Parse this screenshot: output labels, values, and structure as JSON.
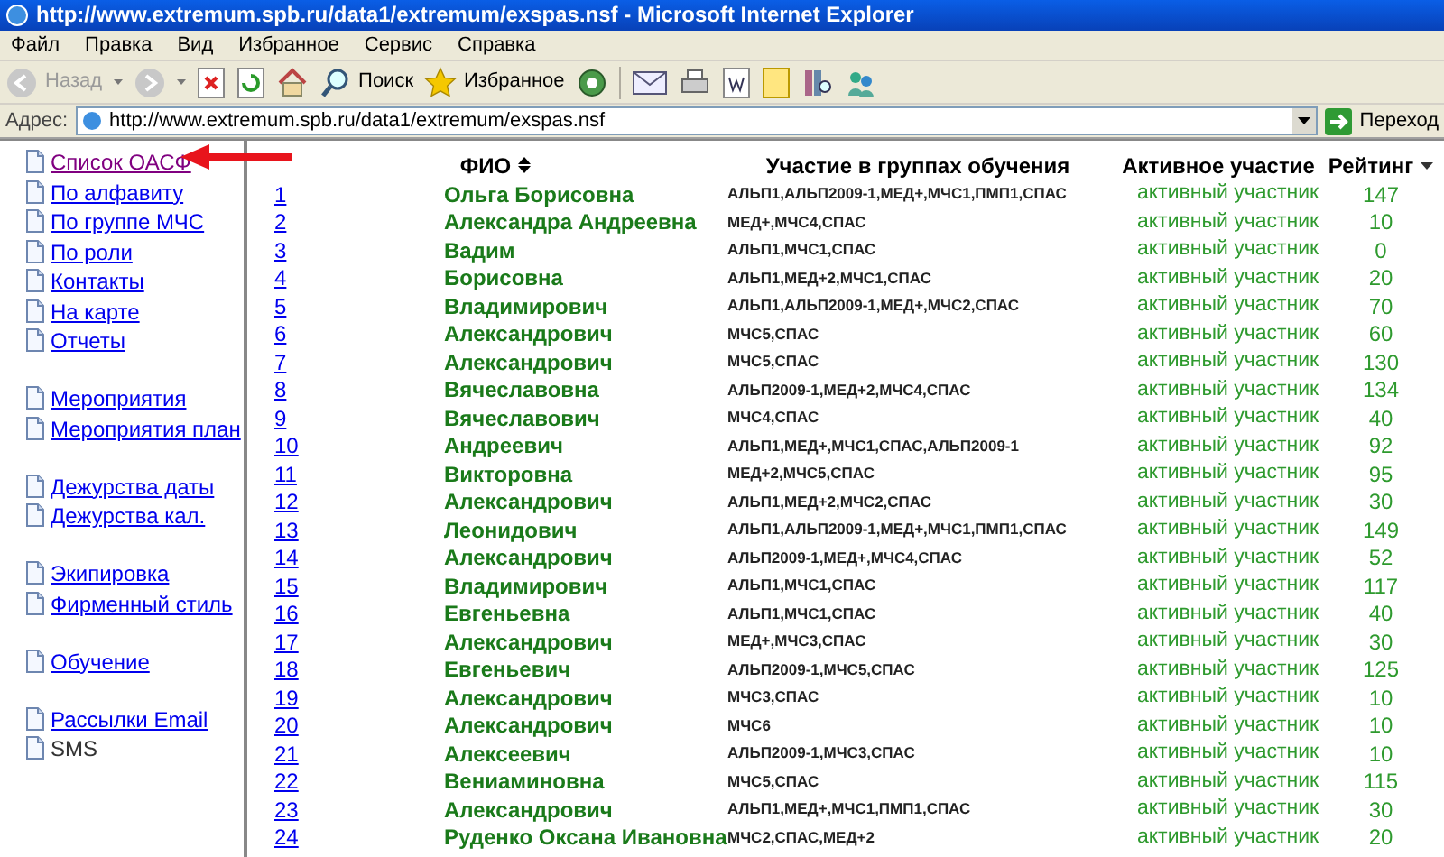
{
  "window": {
    "title": "http://www.extremum.spb.ru/data1/extremum/exspas.nsf - Microsoft Internet Explorer"
  },
  "menu": [
    "Файл",
    "Правка",
    "Вид",
    "Избранное",
    "Сервис",
    "Справка"
  ],
  "toolbar": {
    "back": {
      "label": "Назад",
      "disabled": true
    },
    "search": "Поиск",
    "favorites": "Избранное"
  },
  "address": {
    "label": "Адрес:",
    "value": "http://www.extremum.spb.ru/data1/extremum/exspas.nsf",
    "go": "Переход"
  },
  "sidebar": {
    "groups": [
      [
        {
          "label": "Список ОАСФ",
          "kind": "link",
          "visited": true
        },
        {
          "label": "По алфавиту",
          "kind": "link",
          "visited": false
        },
        {
          "label": "По группе МЧС",
          "kind": "link",
          "visited": false
        },
        {
          "label": "По роли",
          "kind": "link",
          "visited": false
        },
        {
          "label": "Контакты",
          "kind": "link",
          "visited": false
        },
        {
          "label": "На карте",
          "kind": "link",
          "visited": false
        },
        {
          "label": "Отчеты",
          "kind": "link",
          "visited": false
        }
      ],
      [
        {
          "label": "Мероприятия",
          "kind": "link",
          "visited": false
        },
        {
          "label": "Мероприятия план",
          "kind": "link",
          "visited": false
        }
      ],
      [
        {
          "label": "Дежурства даты",
          "kind": "link",
          "visited": false
        },
        {
          "label": "Дежурства кал.",
          "kind": "link",
          "visited": false
        }
      ],
      [
        {
          "label": "Экипировка",
          "kind": "link",
          "visited": false
        },
        {
          "label": "Фирменный стиль",
          "kind": "link",
          "visited": false
        }
      ],
      [
        {
          "label": "Обучение",
          "kind": "link",
          "visited": false
        }
      ],
      [
        {
          "label": "Рассылки Email",
          "kind": "link",
          "visited": false
        },
        {
          "label": "SMS",
          "kind": "text"
        }
      ]
    ]
  },
  "table": {
    "columns": [
      {
        "label": "ФИО",
        "kind": "sortable"
      },
      {
        "label": "Участие в группах обучения",
        "kind": "plain"
      },
      {
        "label": "Активное участие",
        "kind": "plain"
      },
      {
        "label": "Рейтинг",
        "kind": "sorted"
      }
    ],
    "rows": [
      {
        "n": "1",
        "name": "Ольга Борисовна",
        "groups": "АЛЬП1,АЛЬП2009-1,МЕД+,МЧС1,ПМП1,СПАС",
        "status": "активный участник",
        "rating": "147"
      },
      {
        "n": "2",
        "name": "Александра Андреевна",
        "groups": "МЕД+,МЧС4,СПАС",
        "status": "активный участник",
        "rating": "10"
      },
      {
        "n": "3",
        "name": "Вадим",
        "groups": "АЛЬП1,МЧС1,СПАС",
        "status": "активный участник",
        "rating": "0"
      },
      {
        "n": "4",
        "name": "Борисовна",
        "groups": "АЛЬП1,МЕД+2,МЧС1,СПАС",
        "status": "активный участник",
        "rating": "20"
      },
      {
        "n": "5",
        "name": "Владимирович",
        "groups": "АЛЬП1,АЛЬП2009-1,МЕД+,МЧС2,СПАС",
        "status": "активный участник",
        "rating": "70"
      },
      {
        "n": "6",
        "name": "Александрович",
        "groups": "МЧС5,СПАС",
        "status": "активный участник",
        "rating": "60"
      },
      {
        "n": "7",
        "name": "Александрович",
        "groups": "МЧС5,СПАС",
        "status": "активный участник",
        "rating": "130"
      },
      {
        "n": "8",
        "name": "Вячеславовна",
        "groups": "АЛЬП2009-1,МЕД+2,МЧС4,СПАС",
        "status": "активный участник",
        "rating": "134"
      },
      {
        "n": "9",
        "name": "Вячеславович",
        "groups": "МЧС4,СПАС",
        "status": "активный участник",
        "rating": "40"
      },
      {
        "n": "10",
        "name": "Андреевич",
        "groups": "АЛЬП1,МЕД+,МЧС1,СПАС,АЛЬП2009-1",
        "status": "активный участник",
        "rating": "92"
      },
      {
        "n": "11",
        "name": "Викторовна",
        "groups": "МЕД+2,МЧС5,СПАС",
        "status": "активный участник",
        "rating": "95"
      },
      {
        "n": "12",
        "name": "Александрович",
        "groups": "АЛЬП1,МЕД+2,МЧС2,СПАС",
        "status": "активный участник",
        "rating": "30"
      },
      {
        "n": "13",
        "name": "Леонидович",
        "groups": "АЛЬП1,АЛЬП2009-1,МЕД+,МЧС1,ПМП1,СПАС",
        "status": "активный участник",
        "rating": "149"
      },
      {
        "n": "14",
        "name": "Александрович",
        "groups": "АЛЬП2009-1,МЕД+,МЧС4,СПАС",
        "status": "активный участник",
        "rating": "52"
      },
      {
        "n": "15",
        "name": "Владимирович",
        "groups": "АЛЬП1,МЧС1,СПАС",
        "status": "активный участник",
        "rating": "117"
      },
      {
        "n": "16",
        "name": "Евгеньевна",
        "groups": "АЛЬП1,МЧС1,СПАС",
        "status": "активный участник",
        "rating": "40"
      },
      {
        "n": "17",
        "name": "Александрович",
        "groups": "МЕД+,МЧС3,СПАС",
        "status": "активный участник",
        "rating": "30"
      },
      {
        "n": "18",
        "name": "Евгеньевич",
        "groups": "АЛЬП2009-1,МЧС5,СПАС",
        "status": "активный участник",
        "rating": "125"
      },
      {
        "n": "19",
        "name": "Александрович",
        "groups": "МЧС3,СПАС",
        "status": "активный участник",
        "rating": "10"
      },
      {
        "n": "20",
        "name": "Александрович",
        "groups": "МЧС6",
        "status": "активный участник",
        "rating": "10"
      },
      {
        "n": "21",
        "name": "Алексеевич",
        "groups": "АЛЬП2009-1,МЧС3,СПАС",
        "status": "активный участник",
        "rating": "10"
      },
      {
        "n": "22",
        "name": "Вениаминовна",
        "groups": "МЧС5,СПАС",
        "status": "активный участник",
        "rating": "115"
      },
      {
        "n": "23",
        "name": "Александрович",
        "groups": "АЛЬП1,МЕД+,МЧС1,ПМП1,СПАС",
        "status": "активный участник",
        "rating": "30"
      },
      {
        "n": "24",
        "name": "Руденко Оксана Ивановна",
        "groups": "МЧС2,СПАС,МЕД+2",
        "status": "активный участник",
        "rating": "20"
      }
    ]
  }
}
